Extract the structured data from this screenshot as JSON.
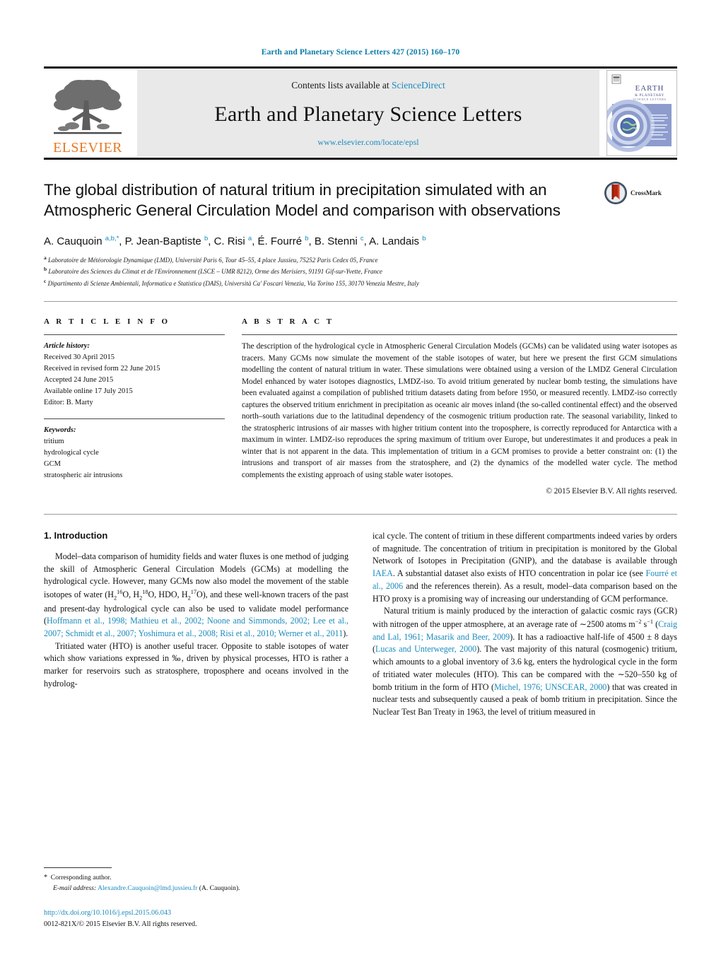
{
  "running_head": "Earth and Planetary Science Letters 427 (2015) 160–170",
  "masthead": {
    "contents_prefix": "Contents lists available at ",
    "sciencedirect": "ScienceDirect",
    "journal_title": "Earth and Planetary Science Letters",
    "journal_url": "www.elsevier.com/locate/epsl",
    "publisher_wordmark": "ELSEVIER",
    "cover_title_line1": "EARTH",
    "cover_title_line2": "& PLANETARY",
    "cover_title_line3": "SCIENCE LETTERS"
  },
  "article": {
    "title": "The global distribution of natural tritium in precipitation simulated with an Atmospheric General Circulation Model and comparison with observations",
    "crossmark_label": "CrossMark",
    "authors_html": "A. Cauquoin <sup>a,b,</sup><sup>*</sup>, P. Jean-Baptiste <sup>b</sup>, C. Risi <sup>a</sup>, É. Fourré <sup>b</sup>, B. Stenni <sup>c</sup>, A. Landais <sup>b</sup>",
    "affiliations": [
      {
        "mark": "a",
        "text": "Laboratoire de Météorologie Dynamique (LMD), Université Paris 6, Tour 45–55, 4 place Jussieu, 75252 Paris Cedex 05, France"
      },
      {
        "mark": "b",
        "text": "Laboratoire des Sciences du Climat et de l'Environnement (LSCE – UMR 8212), Orme des Merisiers, 91191 Gif-sur-Yvette, France"
      },
      {
        "mark": "c",
        "text": "Dipartimento di Scienze Ambientali, Informatica e Statistica (DAIS), Università Ca' Foscari Venezia, Via Torino 155, 30170 Venezia Mestre, Italy"
      }
    ]
  },
  "info": {
    "heading": "A R T I C L E    I N F O",
    "history_label": "Article history:",
    "history": [
      "Received 30 April 2015",
      "Received in revised form 22 June 2015",
      "Accepted 24 June 2015",
      "Available online 17 July 2015",
      "Editor: B. Marty"
    ],
    "keywords_label": "Keywords:",
    "keywords": [
      "tritium",
      "hydrological cycle",
      "GCM",
      "stratospheric air intrusions"
    ]
  },
  "abstract": {
    "heading": "A B S T R A C T",
    "text": "The description of the hydrological cycle in Atmospheric General Circulation Models (GCMs) can be validated using water isotopes as tracers. Many GCMs now simulate the movement of the stable isotopes of water, but here we present the first GCM simulations modelling the content of natural tritium in water. These simulations were obtained using a version of the LMDZ General Circulation Model enhanced by water isotopes diagnostics, LMDZ-iso. To avoid tritium generated by nuclear bomb testing, the simulations have been evaluated against a compilation of published tritium datasets dating from before 1950, or measured recently. LMDZ-iso correctly captures the observed tritium enrichment in precipitation as oceanic air moves inland (the so-called continental effect) and the observed north–south variations due to the latitudinal dependency of the cosmogenic tritium production rate. The seasonal variability, linked to the stratospheric intrusions of air masses with higher tritium content into the troposphere, is correctly reproduced for Antarctica with a maximum in winter. LMDZ-iso reproduces the spring maximum of tritium over Europe, but underestimates it and produces a peak in winter that is not apparent in the data. This implementation of tritium in a GCM promises to provide a better constraint on: (1) the intrusions and transport of air masses from the stratosphere, and (2) the dynamics of the modelled water cycle. The method complements the existing approach of using stable water isotopes.",
    "copyright": "© 2015 Elsevier B.V. All rights reserved."
  },
  "body": {
    "section_heading": "1. Introduction",
    "left_paragraphs": [
      {
        "segments": [
          {
            "t": "Model–data comparison of humidity fields and water fluxes is one method of judging the skill of Atmospheric General Circulation Models (GCMs) at modelling the hydrological cycle. However, many GCMs now also model the movement of the stable isotopes of water (H",
            "link": false
          },
          {
            "t": "SUBSUP_H2_16O",
            "link": false
          },
          {
            "t": "), and these well-known tracers of the past and present-day hydrological cycle can also be used to validate model performance (",
            "link": false
          },
          {
            "t": "Hoffmann et al., 1998; Mathieu et al., 2002; Noone and Simmonds, 2002; Lee et al., 2007; Schmidt et al., 2007; Yoshimura et al., 2008; Risi et al., 2010; Werner et al., 2011",
            "link": true
          },
          {
            "t": ").",
            "link": false
          }
        ]
      },
      {
        "segments": [
          {
            "t": "Tritiated water (HTO) is another useful tracer. Opposite to stable isotopes of water which show variations expressed in ‰, driven by physical processes, HTO is rather a marker for reservoirs such as stratosphere, troposphere and oceans involved in the hydrolog-",
            "link": false
          }
        ]
      }
    ],
    "right_paragraphs": [
      {
        "segments": [
          {
            "t": "ical cycle. The content of tritium in these different compartments indeed varies by orders of magnitude. The concentration of tritium in precipitation is monitored by the Global Network of Isotopes in Precipitation (GNIP), and the database is available through ",
            "link": false
          },
          {
            "t": "IAEA",
            "link": true
          },
          {
            "t": ". A substantial dataset also exists of HTO concentration in polar ice (see ",
            "link": false
          },
          {
            "t": "Fourré et al., 2006",
            "link": true
          },
          {
            "t": " and the references therein). As a result, model–data comparison based on the HTO proxy is a promising way of increasing our understanding of GCM performance.",
            "link": false
          }
        ]
      },
      {
        "segments": [
          {
            "t": "Natural tritium is mainly produced by the interaction of galactic cosmic rays (GCR) with nitrogen of the upper atmosphere, at an average rate of ∼2500 atoms m",
            "link": false
          },
          {
            "t": "SUP_-2_-1",
            "link": false
          },
          {
            "t": " (",
            "link": false
          },
          {
            "t": "Craig and Lal, 1961; Masarik and Beer, 2009",
            "link": true
          },
          {
            "t": "). It has a radioactive half-life of 4500 ± 8 days (",
            "link": false
          },
          {
            "t": "Lucas and Unterweger, 2000",
            "link": true
          },
          {
            "t": "). The vast majority of this natural (cosmogenic) tritium, which amounts to a global inventory of 3.6 kg, enters the hydrological cycle in the form of tritiated water molecules (HTO). This can be compared with the ∼520–550 kg of bomb tritium in the form of HTO (",
            "link": false
          },
          {
            "t": "Michel, 1976; UNSCEAR, 2000",
            "link": true
          },
          {
            "t": ") that was created in nuclear tests and subsequently caused a peak of bomb tritium in precipitation. Since the Nuclear Test Ban Treaty in 1963, the level of tritium measured in",
            "link": false
          }
        ]
      }
    ]
  },
  "footnote": {
    "star": "*",
    "corresponding": "Corresponding author.",
    "email_label": "E-mail address:",
    "email": "Alexandre.Cauquoin@lmd.jussieu.fr",
    "email_suffix": "(A. Cauquoin)."
  },
  "doi_block": {
    "doi": "http://dx.doi.org/10.1016/j.epsl.2015.06.043",
    "issn_line": "0012-821X/© 2015 Elsevier B.V. All rights reserved."
  },
  "colors": {
    "link": "#1b8bbd",
    "running_head": "#0b7ca8",
    "elsevier_orange": "#e87722",
    "masthead_bg": "#e9e9e9"
  }
}
